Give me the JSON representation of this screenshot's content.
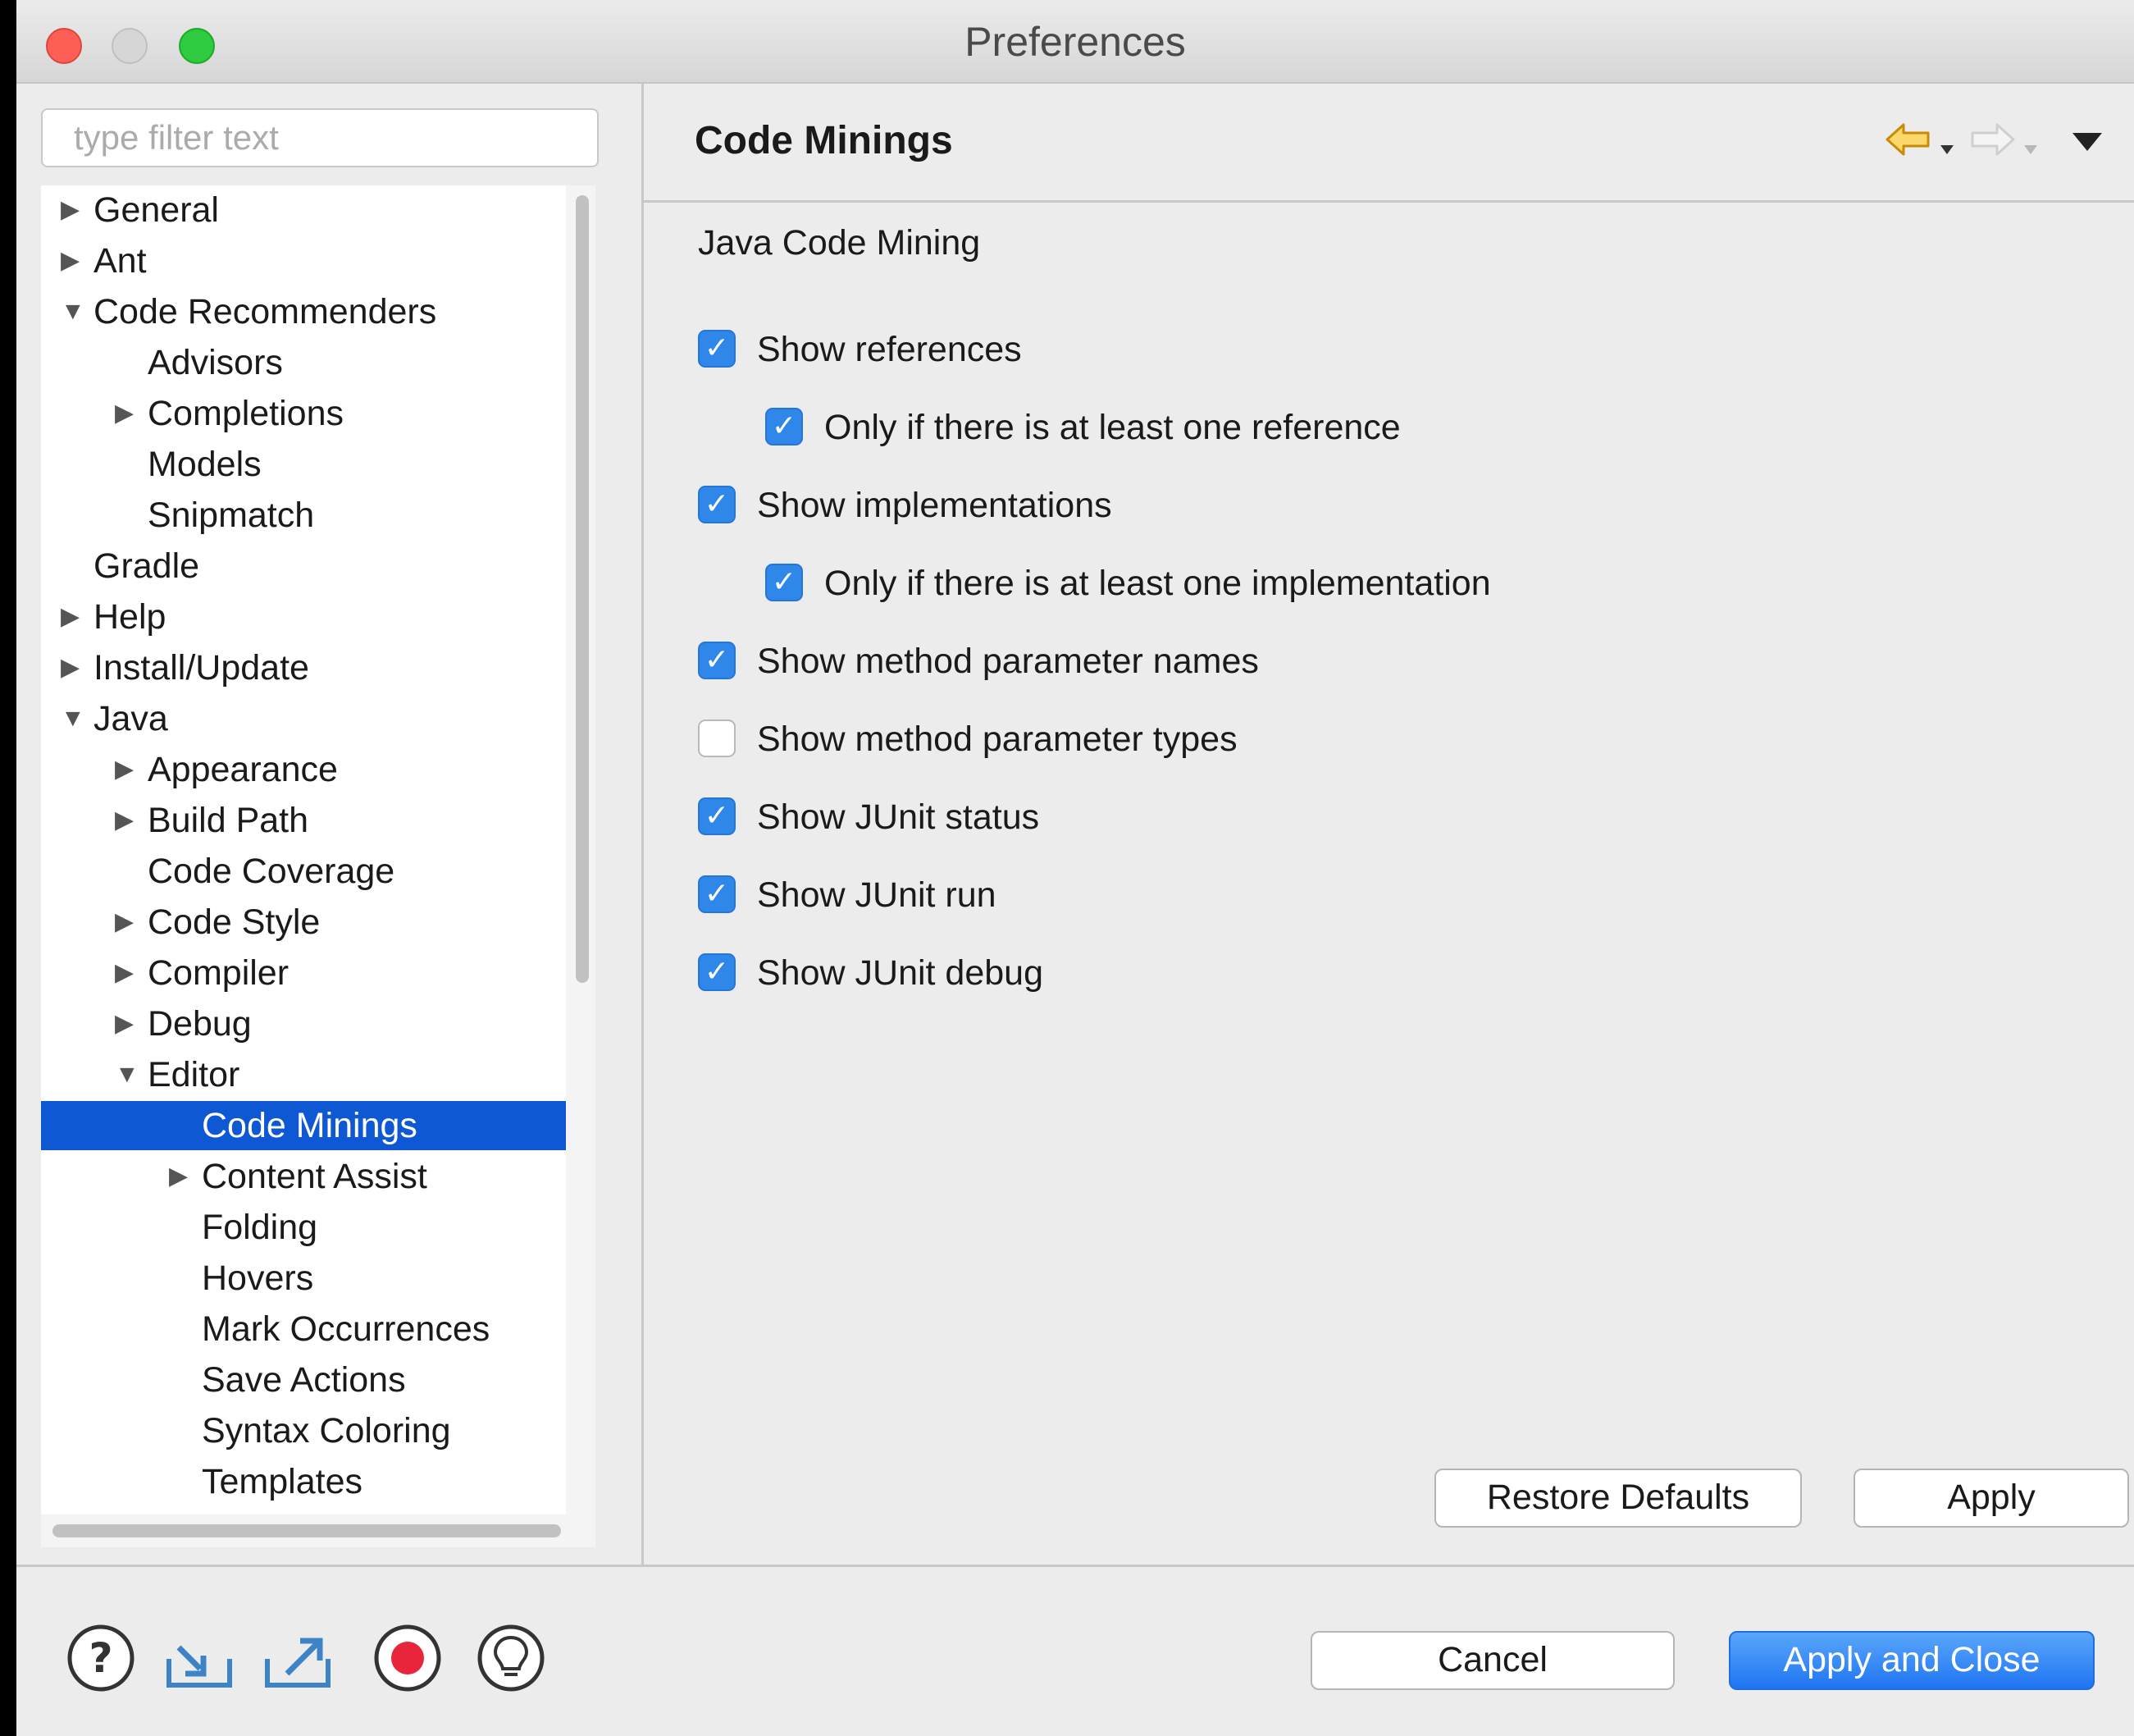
{
  "window": {
    "title": "Preferences"
  },
  "filter": {
    "placeholder": "type filter text",
    "value": ""
  },
  "tree": [
    {
      "label": "General",
      "depth": 0,
      "expander": "collapsed"
    },
    {
      "label": "Ant",
      "depth": 0,
      "expander": "collapsed"
    },
    {
      "label": "Code Recommenders",
      "depth": 0,
      "expander": "expanded"
    },
    {
      "label": "Advisors",
      "depth": 1,
      "expander": "none"
    },
    {
      "label": "Completions",
      "depth": 1,
      "expander": "collapsed"
    },
    {
      "label": "Models",
      "depth": 1,
      "expander": "none"
    },
    {
      "label": "Snipmatch",
      "depth": 1,
      "expander": "none"
    },
    {
      "label": "Gradle",
      "depth": 0,
      "expander": "none"
    },
    {
      "label": "Help",
      "depth": 0,
      "expander": "collapsed"
    },
    {
      "label": "Install/Update",
      "depth": 0,
      "expander": "collapsed"
    },
    {
      "label": "Java",
      "depth": 0,
      "expander": "expanded"
    },
    {
      "label": "Appearance",
      "depth": 1,
      "expander": "collapsed"
    },
    {
      "label": "Build Path",
      "depth": 1,
      "expander": "collapsed"
    },
    {
      "label": "Code Coverage",
      "depth": 1,
      "expander": "none"
    },
    {
      "label": "Code Style",
      "depth": 1,
      "expander": "collapsed"
    },
    {
      "label": "Compiler",
      "depth": 1,
      "expander": "collapsed"
    },
    {
      "label": "Debug",
      "depth": 1,
      "expander": "collapsed"
    },
    {
      "label": "Editor",
      "depth": 1,
      "expander": "expanded"
    },
    {
      "label": "Code Minings",
      "depth": 2,
      "expander": "none",
      "selected": true
    },
    {
      "label": "Content Assist",
      "depth": 2,
      "expander": "collapsed"
    },
    {
      "label": "Folding",
      "depth": 2,
      "expander": "none"
    },
    {
      "label": "Hovers",
      "depth": 2,
      "expander": "none"
    },
    {
      "label": "Mark Occurrences",
      "depth": 2,
      "expander": "none"
    },
    {
      "label": "Save Actions",
      "depth": 2,
      "expander": "none"
    },
    {
      "label": "Syntax Coloring",
      "depth": 2,
      "expander": "none"
    },
    {
      "label": "Templates",
      "depth": 2,
      "expander": "none"
    }
  ],
  "page": {
    "title": "Code Minings",
    "section_label": "Java Code Mining",
    "nav_icons": {
      "back": "back-arrow-icon",
      "forward": "forward-arrow-icon",
      "menu": "view-menu-icon"
    },
    "options": [
      {
        "id": "show-references",
        "label": "Show references",
        "checked": true,
        "indent": 0
      },
      {
        "id": "only-one-reference",
        "label": "Only if there is at least one reference",
        "checked": true,
        "indent": 1
      },
      {
        "id": "show-implementations",
        "label": "Show implementations",
        "checked": true,
        "indent": 0
      },
      {
        "id": "only-one-implementation",
        "label": "Only if there is at least one implementation",
        "checked": true,
        "indent": 1
      },
      {
        "id": "show-param-names",
        "label": "Show method parameter names",
        "checked": true,
        "indent": 0
      },
      {
        "id": "show-param-types",
        "label": "Show method parameter types",
        "checked": false,
        "indent": 0
      },
      {
        "id": "show-junit-status",
        "label": "Show JUnit status",
        "checked": true,
        "indent": 0
      },
      {
        "id": "show-junit-run",
        "label": "Show JUnit run",
        "checked": true,
        "indent": 0
      },
      {
        "id": "show-junit-debug",
        "label": "Show JUnit debug",
        "checked": true,
        "indent": 0
      }
    ],
    "restore_defaults": "Restore Defaults",
    "apply": "Apply"
  },
  "footer": {
    "icons": [
      "help-icon",
      "import-icon",
      "export-icon",
      "record-icon",
      "tip-icon"
    ],
    "cancel": "Cancel",
    "apply_and_close": "Apply and Close"
  },
  "colors": {
    "selection": "#0f58d4",
    "checkbox": "#2f87ea",
    "primary_button": "#1f75f2",
    "back_arrow": "#f3b21b"
  }
}
